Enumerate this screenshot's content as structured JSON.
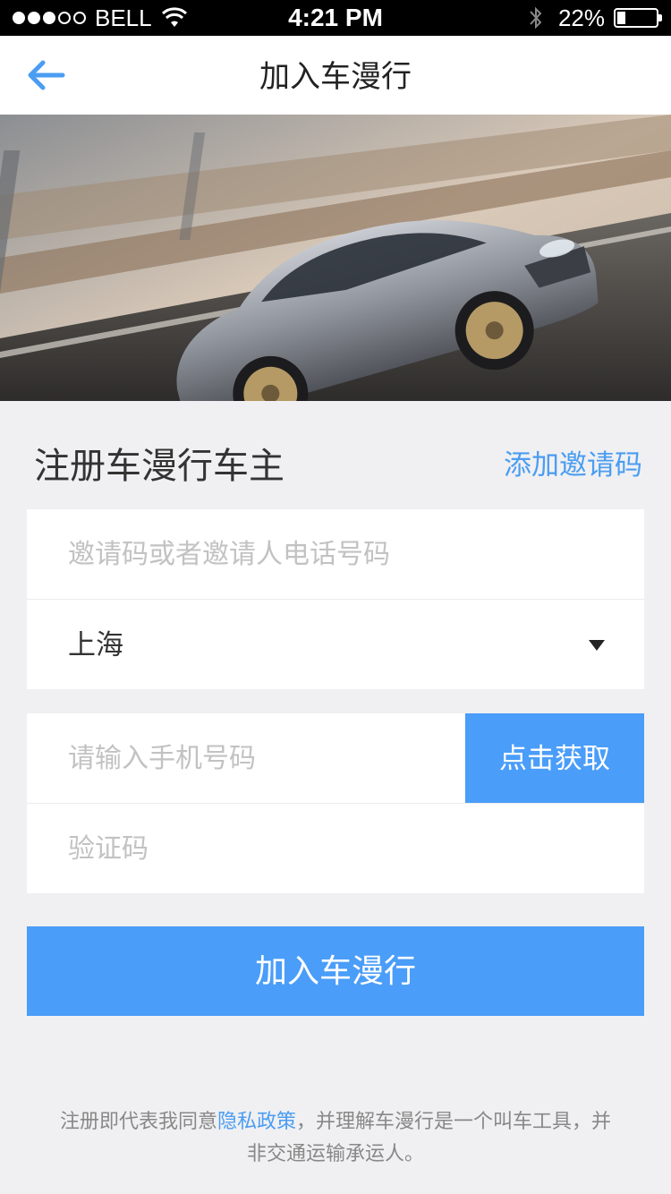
{
  "status_bar": {
    "carrier": "BELL",
    "time": "4:21 PM",
    "battery_percent": "22%",
    "battery_level": 0.22,
    "signal_strength": 3,
    "signal_max": 5
  },
  "nav": {
    "title": "加入车漫行",
    "back_icon": "arrow-left-icon"
  },
  "hero": {
    "image": "silver sports car driving on highway"
  },
  "form": {
    "title": "注册车漫行车主",
    "invite_link": "添加邀请码",
    "invite_placeholder": "邀请码或者邀请人电话号码",
    "city_value": "上海",
    "phone_placeholder": "请输入手机号码",
    "get_code_label": "点击获取",
    "code_placeholder": "验证码",
    "submit_label": "加入车漫行"
  },
  "agreement": {
    "prefix": "注册即代表我同意",
    "policy_link": "隐私政策",
    "suffix": "，并理解车漫行是一个叫车工具，并非交通运输承运人。"
  },
  "colors": {
    "accent": "#4a9df9",
    "background": "#f0f0f2",
    "text": "#333333",
    "placeholder": "#c2c2c2"
  }
}
